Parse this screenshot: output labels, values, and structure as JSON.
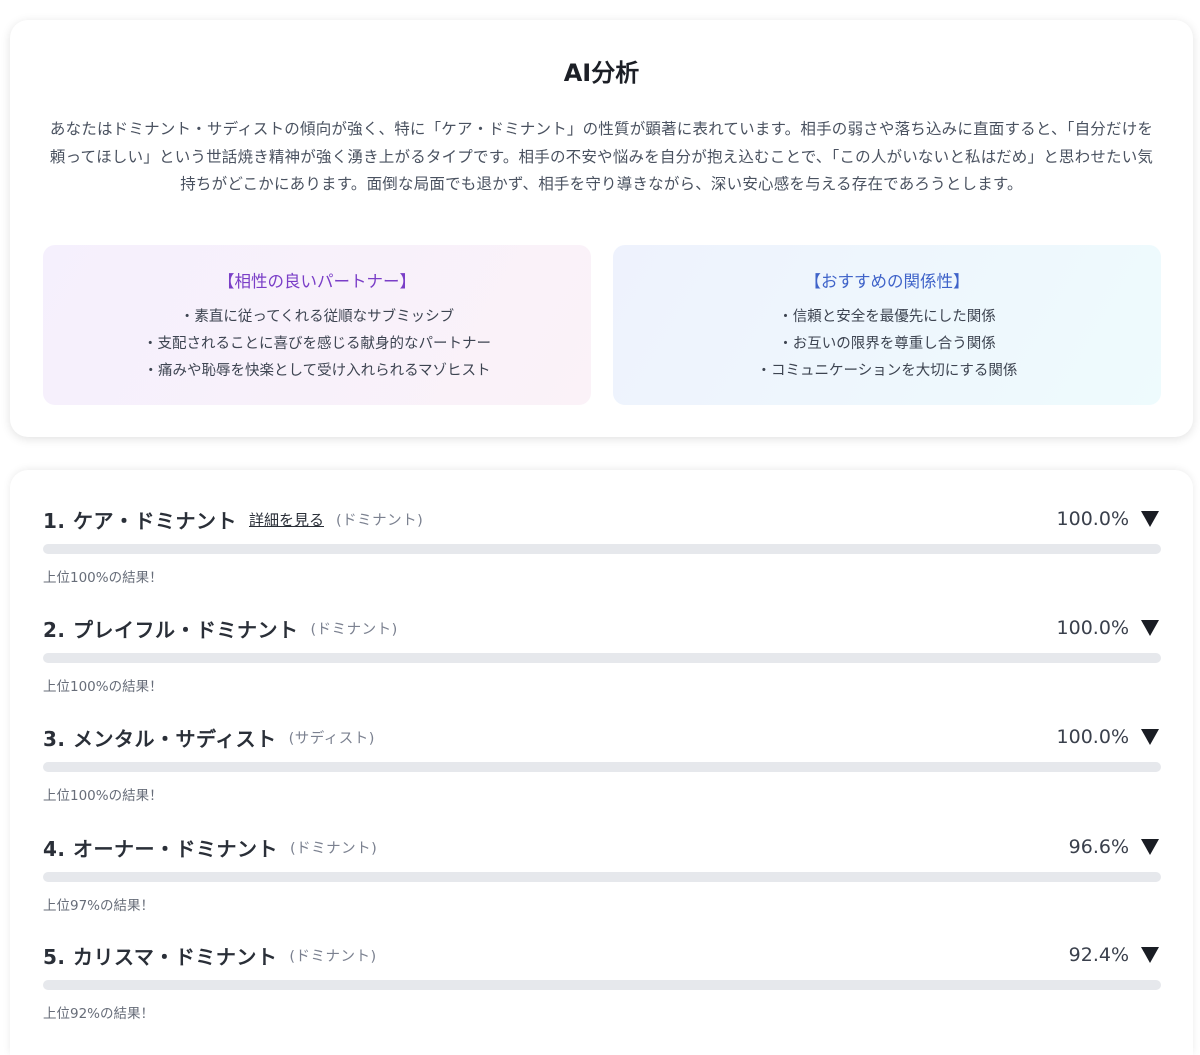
{
  "analysis": {
    "title": "AI分析",
    "body": "あなたはドミナント・サディストの傾向が強く、特に「ケア・ドミナント」の性質が顕著に表れています。相手の弱さや落ち込みに直面すると、「自分だけを頼ってほしい」という世話焼き精神が強く湧き上がるタイプです。相手の不安や悩みを自分が抱え込むことで、「この人がいないと私はだめ」と思わせたい気持ちがどこかにあります。面倒な局面でも退かず、相手を守り導きながら、深い安心感を与える存在であろうとします。",
    "partner": {
      "heading": "【相性の良いパートナー】",
      "items": [
        "・素直に従ってくれる従順なサブミッシブ",
        "・支配されることに喜びを感じる献身的なパートナー",
        "・痛みや恥辱を快楽として受け入れられるマゾヒスト"
      ]
    },
    "relation": {
      "heading": "【おすすめの関係性】",
      "items": [
        "・信頼と安全を最優先にした関係",
        "・お互いの限界を尊重し合う関係",
        "・コミュニケーションを大切にする関係"
      ]
    }
  },
  "results": [
    {
      "name": "1. ケア・ドミナント",
      "detail_link": "詳細を見る",
      "category": "(ドミナント)",
      "percent": "100.0%",
      "value": 1.0,
      "note": "上位100%の結果！"
    },
    {
      "name": "2. プレイフル・ドミナント",
      "category": "(ドミナント)",
      "percent": "100.0%",
      "value": 1.0,
      "note": "上位100%の結果！"
    },
    {
      "name": "3. メンタル・サディスト",
      "category": "(サディスト)",
      "percent": "100.0%",
      "value": 1.0,
      "note": "上位100%の結果！"
    },
    {
      "name": "4. オーナー・ドミナント",
      "category": "(ドミナント)",
      "percent": "96.6%",
      "value": 0.966,
      "note": "上位97%の結果！"
    },
    {
      "name": "5. カリスマ・ドミナント",
      "category": "(ドミナント)",
      "percent": "92.4%",
      "value": 0.924,
      "note": "上位92%の結果！"
    }
  ],
  "colors": {
    "bar_track": "#e6e8ec",
    "partner_heading": "#7a3ec7",
    "relation_heading": "#3f63c9"
  },
  "icons": {
    "expand": "triangle-down-icon"
  }
}
